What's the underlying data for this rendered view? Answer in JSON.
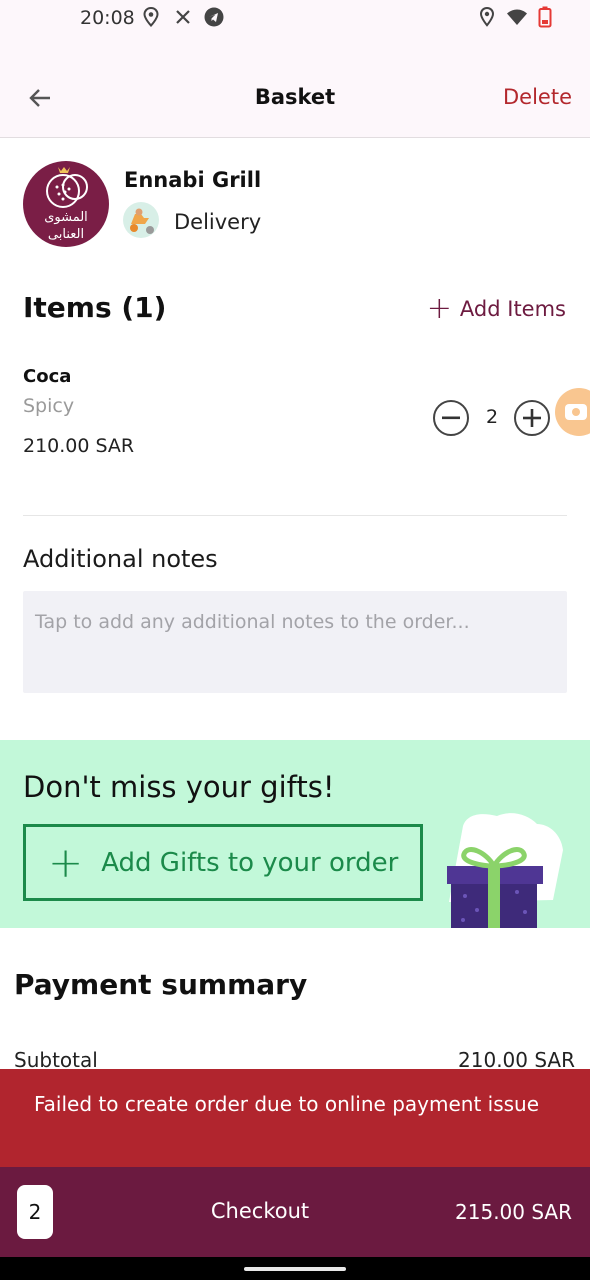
{
  "status_bar": {
    "time": "20:08",
    "icons": [
      "location-icon",
      "close-icon",
      "telegram-icon",
      "location-icon",
      "wifi-icon",
      "battery-low-icon"
    ],
    "battery_color": "#e53935"
  },
  "app_bar": {
    "title": "Basket",
    "delete_label": "Delete",
    "back_icon": "arrow-left-icon"
  },
  "restaurant": {
    "name": "Ennabi Grill",
    "logo_text_line1": "المشوى",
    "logo_text_line2": "العنابى",
    "delivery_label": "Delivery",
    "brand_color": "#7a1e46"
  },
  "items_section": {
    "title": "Items  (1)",
    "add_items_label": "Add Items",
    "items": [
      {
        "name": "Coca",
        "option": "Spicy",
        "price": "210.00 SAR",
        "quantity": "2"
      }
    ]
  },
  "notes": {
    "title": "Additional notes",
    "placeholder": "Tap to add any additional notes to the order..."
  },
  "gifts": {
    "title": "Don't miss your gifts!",
    "button_label": "Add Gifts to your order",
    "accent_color": "#1b8a4a"
  },
  "payment_summary": {
    "title": "Payment summary",
    "subtotal_label": "Subtotal",
    "subtotal_value": "210.00 SAR"
  },
  "snackbar": {
    "message": "Failed to create order due to online payment issue",
    "color": "#b1252e"
  },
  "checkout": {
    "count": "2",
    "label": "Checkout",
    "total": "215.00 SAR",
    "color": "#6b1a40"
  }
}
